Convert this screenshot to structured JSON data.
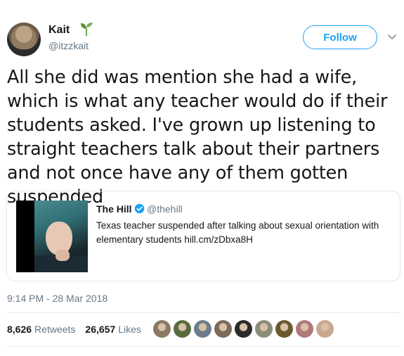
{
  "author": {
    "name": "Kait",
    "name_emoji": "sprout-icon",
    "handle": "@itzzkait"
  },
  "follow_label": "Follow",
  "tweet_text": "All she did was mention she had a wife, which is what any teacher would do if their students asked. I've grown up listening to straight teachers talk about their partners and not once have any of them gotten suspended",
  "quoted": {
    "name": "The Hill",
    "handle": "@thehill",
    "text": "Texas teacher suspended after talking about sexual orientation with elementary students hill.cm/zDbxa8H"
  },
  "timestamp": "9:14 PM - 28 Mar 2018",
  "stats": {
    "retweets_count": "8,626",
    "retweets_label": "Retweets",
    "likes_count": "26,657",
    "likes_label": "Likes"
  },
  "liker_avatar_colors": [
    "#8a7a64",
    "#5a6b3e",
    "#6b7d8c",
    "#7c6a5a",
    "#2a2a2a",
    "#8c8c7a",
    "#6a5a2c",
    "#b07a7a",
    "#c9a890"
  ],
  "colors": {
    "accent": "#1da1f2",
    "text": "#14171a",
    "secondary": "#657786",
    "border": "#e1e8ed"
  }
}
